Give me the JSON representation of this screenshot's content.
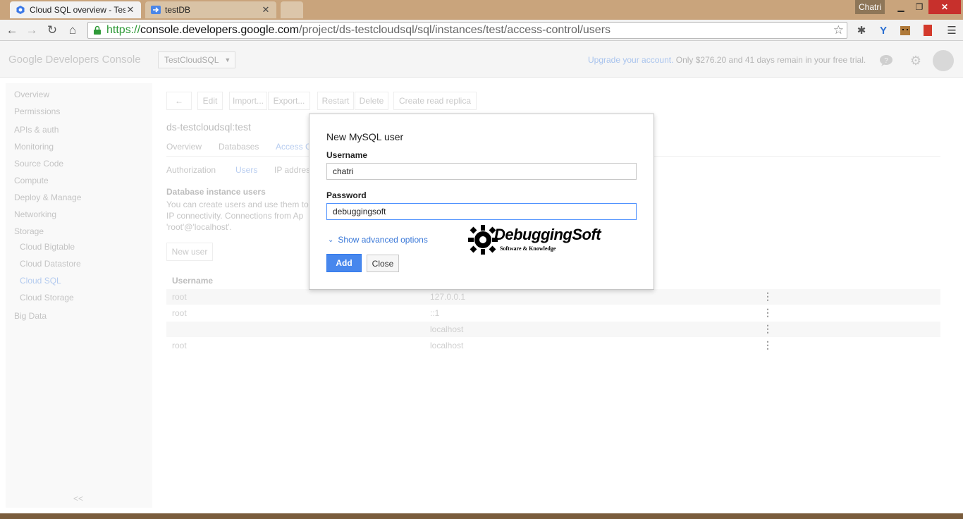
{
  "browser": {
    "tabs": [
      {
        "title": "Cloud SQL overview - Test",
        "active": true
      },
      {
        "title": "testDB",
        "active": false
      }
    ],
    "window_user": "Chatri",
    "url": {
      "proto": "https://",
      "host": "console.developers.google.com",
      "path": "/project/ds-testcloudsql/sql/instances/test/access-control/users"
    }
  },
  "header": {
    "brand": "Google Developers Console",
    "project": "TestCloudSQL",
    "upgrade_link": "Upgrade your account.",
    "trial_text": " Only $276.20 and 41 days remain in your free trial."
  },
  "sidebar": {
    "items": [
      {
        "label": "Overview"
      },
      {
        "label": "Permissions"
      },
      {
        "label": "APIs & auth"
      },
      {
        "label": "Monitoring"
      },
      {
        "label": "Source Code"
      },
      {
        "label": "Compute"
      },
      {
        "label": "Deploy & Manage"
      },
      {
        "label": "Networking"
      },
      {
        "label": "Storage"
      },
      {
        "label": "Cloud Bigtable"
      },
      {
        "label": "Cloud Datastore"
      },
      {
        "label": "Cloud SQL"
      },
      {
        "label": "Cloud Storage"
      },
      {
        "label": "Big Data"
      }
    ],
    "collapse": "<<"
  },
  "main": {
    "back": "←",
    "actions": [
      "Edit",
      "Import...",
      "Export...",
      "Restart",
      "Delete",
      "Create read replica"
    ],
    "instance": "ds-testcloudsql:test",
    "tabs": [
      "Overview",
      "Databases",
      "Access C"
    ],
    "subtabs": [
      "Authorization",
      "Users",
      "IP addres"
    ],
    "section_title": "Database instance users",
    "desc": [
      "You can create users and use them to",
      "IP connectivity. Connections from Ap",
      "'root'@'localhost'."
    ],
    "new_user": "New user",
    "col_username": "Username",
    "rows": [
      {
        "user": "root",
        "host": "127.0.0.1"
      },
      {
        "user": "root",
        "host": "::1"
      },
      {
        "user": "",
        "host": "localhost"
      },
      {
        "user": "root",
        "host": "localhost"
      }
    ],
    "row_menu": "⋮"
  },
  "modal": {
    "title": "New MySQL user",
    "username_label": "Username",
    "username_value": "chatri",
    "password_label": "Password",
    "password_value": "debuggingsoft",
    "advanced": "Show advanced options",
    "add": "Add",
    "close": "Close"
  },
  "watermark": {
    "name": "DebuggingSoft",
    "tagline": "Software & Knowledge"
  }
}
